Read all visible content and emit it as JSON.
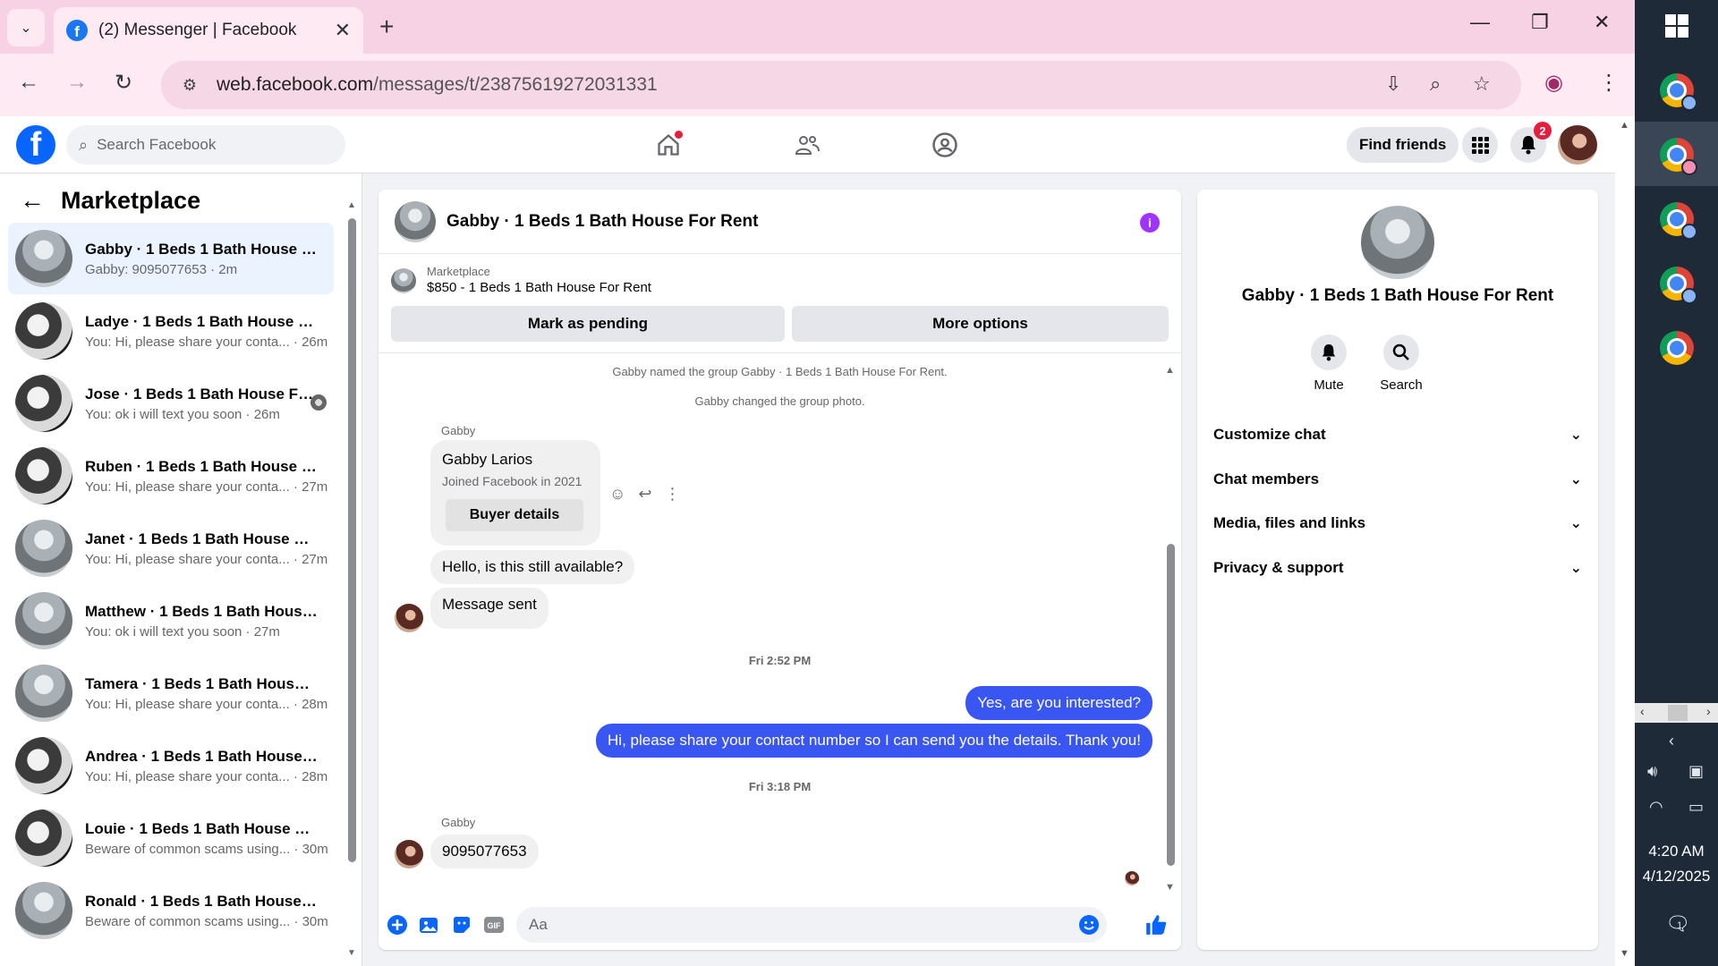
{
  "browser": {
    "tab_title": "(2) Messenger | Facebook",
    "url_host": "web.facebook.com",
    "url_path": "/messages/t/23875619272031331"
  },
  "fb_header": {
    "search_placeholder": "Search Facebook",
    "find_friends": "Find friends",
    "notifications_count": "2"
  },
  "sidebar": {
    "title": "Marketplace",
    "conversations": [
      {
        "name": "Gabby · 1 Beds 1 Bath House Fo...",
        "snippet": "Gabby: 9095077653 · 2m"
      },
      {
        "name": "Ladye · 1 Beds 1 Bath House For...",
        "snippet": "You: Hi, please share your conta... · 26m"
      },
      {
        "name": "Jose · 1 Beds 1 Bath House Fo...",
        "snippet": "You: ok i will text you soon · 26m"
      },
      {
        "name": "Ruben · 1 Beds 1 Bath House Fo...",
        "snippet": "You: Hi, please share your conta... · 27m"
      },
      {
        "name": "Janet · 1 Beds 1 Bath House For ...",
        "snippet": "You: Hi, please share your conta... · 27m"
      },
      {
        "name": "Matthew · 1 Beds 1 Bath House ...",
        "snippet": "You: ok i will text you soon · 27m"
      },
      {
        "name": "Tamera · 1 Beds 1 Bath House F...",
        "snippet": "You: Hi, please share your conta... · 28m"
      },
      {
        "name": "Andrea · 1 Beds 1 Bath House F...",
        "snippet": "You: Hi, please share your conta... · 28m"
      },
      {
        "name": "Louie · 1 Beds 1 Bath House For ...",
        "snippet": "Beware of common scams using... · 30m"
      },
      {
        "name": "Ronald · 1 Beds 1 Bath House Fo...",
        "snippet": "Beware of common scams using... · 30m"
      }
    ]
  },
  "chat": {
    "title": "Gabby · 1 Beds 1 Bath House For Rent",
    "marketplace_label": "Marketplace",
    "listing": "$850 - 1 Beds 1 Bath House For Rent",
    "mark_pending": "Mark as pending",
    "more_options": "More options",
    "system_1": "Gabby named the group Gabby · 1 Beds 1 Bath House For Rent.",
    "system_2": "Gabby changed the group photo.",
    "sender_1": "Gabby",
    "card_name": "Gabby Larios",
    "card_joined": "Joined Facebook in 2021",
    "card_button": "Buyer details",
    "msg_1": "Hello, is this still available?",
    "msg_2": "Message sent",
    "time_1": "Fri 2:52 PM",
    "msg_3": "Yes, are you interested?",
    "msg_4": "Hi, please share your contact number so I can send you the details. Thank you!",
    "time_2": "Fri 3:18 PM",
    "sender_2": "Gabby",
    "msg_5": "9095077653",
    "input_placeholder": "Aa"
  },
  "info_panel": {
    "name": "Gabby · 1 Beds 1 Bath House For Rent",
    "mute": "Mute",
    "search": "Search",
    "rows": [
      "Customize chat",
      "Chat members",
      "Media, files and links",
      "Privacy & support"
    ]
  },
  "taskbar": {
    "time": "4:20 AM",
    "date": "4/12/2025",
    "notif_count": "1"
  }
}
